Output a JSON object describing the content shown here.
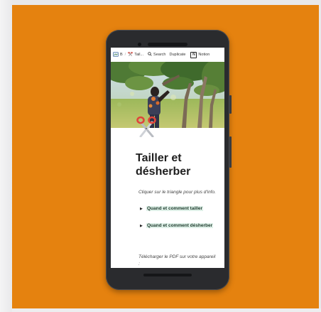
{
  "topbar": {
    "crumb1_label": "B",
    "crumb2_label": "Tail...",
    "search_label": "Search",
    "duplicate_label": "Duplicate",
    "notion_label": "Notion",
    "notion_logo_letter": "N"
  },
  "page": {
    "icon": "scissors-icon",
    "title": "Tailler et désherber",
    "hint": "Cliquer sur le triangle pour plus d'info.",
    "toggles": [
      {
        "label": "Quand et comment tailler"
      },
      {
        "label": "Quand et comment désherber"
      }
    ],
    "download_text": "Télécharger le PDF sur votre appareil :"
  },
  "colors": {
    "background_panel": "#e5820f",
    "phone_body": "#2a2b2e",
    "toggle_highlight": "#dff0e8",
    "scissors_handle": "#e0443a"
  }
}
